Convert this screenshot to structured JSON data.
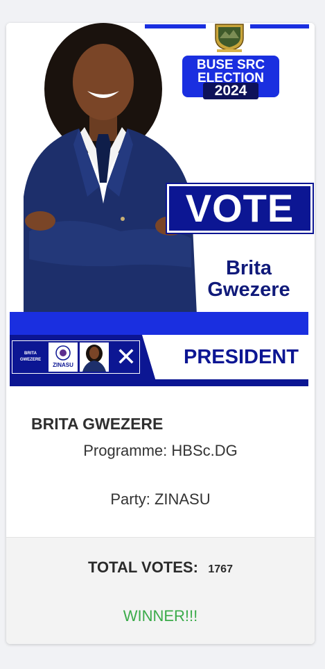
{
  "poster": {
    "badge_line1": "BUSE SRC",
    "badge_line2": "ELECTION",
    "badge_year": "2024",
    "vote_text": "VOTE",
    "name_line1": "Brita",
    "name_line2": "Gwezere",
    "position": "PRESIDENT",
    "ballot_name_line1": "BRITA",
    "ballot_name_line2": "GWEZERE",
    "ballot_party": "ZINASU",
    "ballot_mark": "✕",
    "colors": {
      "primary_blue": "#1a2fe0",
      "navy": "#0c1693"
    }
  },
  "candidate": {
    "full_name": "BRITA GWEZERE",
    "programme": "Programme: HBSc.DG",
    "party": "Party: ZINASU"
  },
  "results": {
    "total_votes_label": "TOTAL VOTES:",
    "total_votes_value": "1767",
    "status": "WINNER!!!",
    "status_color": "#3bab4a"
  }
}
